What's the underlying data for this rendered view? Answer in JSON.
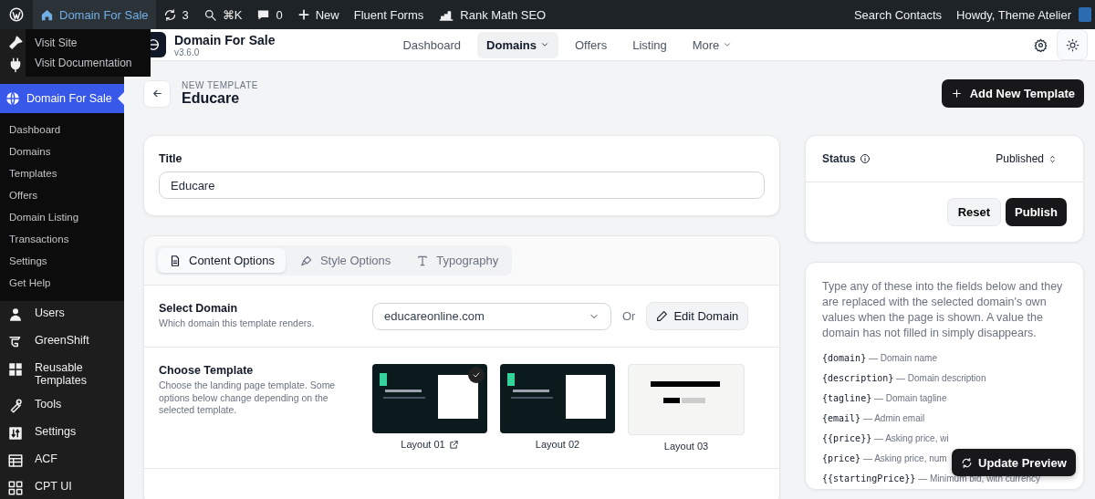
{
  "admin_bar": {
    "items": [
      {
        "kind": "site",
        "label": "Domain For Sale"
      },
      {
        "kind": "updates",
        "label": "3"
      },
      {
        "kind": "search",
        "label": "⌘K"
      },
      {
        "kind": "comments",
        "label": "0"
      },
      {
        "kind": "new",
        "label": "New"
      },
      {
        "kind": "text",
        "label": "Fluent Forms"
      },
      {
        "kind": "seo",
        "label": "Rank Math SEO"
      }
    ],
    "right": [
      "Search Contacts",
      "Howdy, Theme Atelier"
    ],
    "flyout": [
      "Visit Site",
      "Visit Documentation"
    ]
  },
  "sidebar": {
    "current": {
      "label": "Domain For Sale",
      "submenu": [
        "Dashboard",
        "Domains",
        "Templates",
        "Offers",
        "Domain Listing",
        "Transactions",
        "Settings",
        "Get Help"
      ]
    },
    "items": [
      "Users",
      "GreenShift",
      "Reusable Templates",
      "Tools",
      "Settings",
      "ACF",
      "CPT UI"
    ]
  },
  "app_header": {
    "name": "Domain For Sale",
    "version": "v3.6.0",
    "nav": [
      {
        "label": "Dashboard",
        "selected": false,
        "dropdown": false
      },
      {
        "label": "Domains",
        "selected": true,
        "dropdown": true
      },
      {
        "label": "Offers",
        "selected": false,
        "dropdown": false
      },
      {
        "label": "Listing",
        "selected": false,
        "dropdown": false
      },
      {
        "label": "More",
        "selected": false,
        "dropdown": true
      }
    ]
  },
  "page": {
    "eyebrow": "NEW TEMPLATE",
    "title": "Educare",
    "add_button": "Add New Template"
  },
  "title_card": {
    "label": "Title",
    "value": "Educare"
  },
  "options": {
    "tabs": [
      {
        "label": "Content Options",
        "selected": true
      },
      {
        "label": "Style Options",
        "selected": false
      },
      {
        "label": "Typography",
        "selected": false
      }
    ],
    "rows": [
      {
        "kind": "domain",
        "title": "Select Domain",
        "description": "Which domain this template renders.",
        "value": "educareonline.com",
        "or": "Or",
        "button": "Edit Domain"
      },
      {
        "kind": "templates",
        "title": "Choose Template",
        "description": "Choose the landing page template. Some options below change depending on the selected template.",
        "templates": [
          {
            "label": "Layout 01",
            "selected": true
          },
          {
            "label": "Layout 02",
            "selected": false
          },
          {
            "label": "Layout 03",
            "selected": false
          }
        ]
      }
    ]
  },
  "status_card": {
    "label": "Status",
    "value": "Published",
    "reset": "Reset",
    "publish": "Publish"
  },
  "variables": {
    "intro": "Type any of these into the fields below and they are replaced with the selected domain's own values when the page is shown. A value the domain has not filled in simply disappears.",
    "items": [
      {
        "token": "{domain}",
        "description": "— Domain name"
      },
      {
        "token": "{description}",
        "description": "— Domain description"
      },
      {
        "token": "{tagline}",
        "description": "— Domain tagline"
      },
      {
        "token": "{email}",
        "description": "— Admin email"
      },
      {
        "token": "{{price}}",
        "description": "— Asking price, wi"
      },
      {
        "token": "{price}",
        "description": "— Asking price, num"
      },
      {
        "token": "{{startingPrice}}",
        "description": "— Minimum bid, with currency"
      }
    ]
  },
  "update_button": "Update Preview"
}
